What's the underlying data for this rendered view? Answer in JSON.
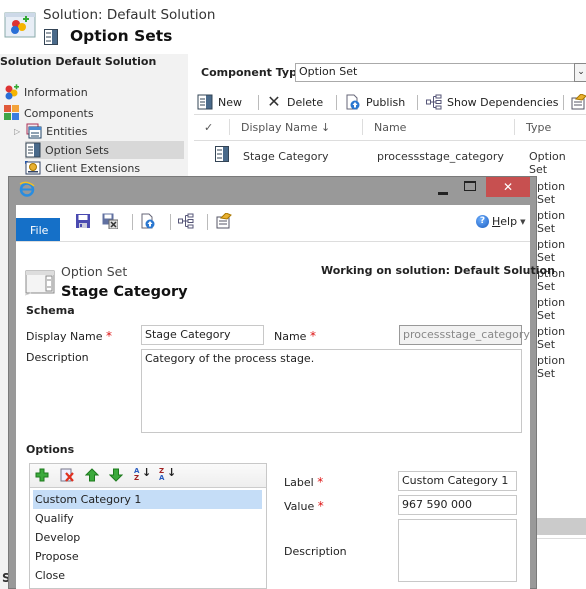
{
  "header": {
    "subtitle": "Solution: Default Solution",
    "title": "Option Sets"
  },
  "sidebar": {
    "title": "Solution Default Solution",
    "items": [
      {
        "label": "Information",
        "icon": "information-icon"
      },
      {
        "label": "Components",
        "icon": "components-icon"
      },
      {
        "label": "Entities",
        "icon": "entities-icon",
        "expandable": true
      },
      {
        "label": "Option Sets",
        "icon": "option-sets-icon",
        "selected": true
      },
      {
        "label": "Client Extensions",
        "icon": "client-extensions-icon"
      }
    ]
  },
  "component_type": {
    "label": "Component Type",
    "value": "Option Set"
  },
  "toolbar": {
    "new_label": "New",
    "delete_label": "Delete",
    "publish_label": "Publish",
    "show_dependencies_label": "Show Dependencies"
  },
  "grid": {
    "columns": [
      "Display Name ↓",
      "Name",
      "Type"
    ],
    "check_glyph": "✓",
    "rows": [
      {
        "display_name": "Stage Category",
        "name": "processstage_category",
        "type": "Option Set"
      }
    ],
    "obscured_type_values": [
      "ption Set",
      "ption Set",
      "ption Set",
      "ption Set",
      "ption Set",
      "ption Set",
      "ption Set"
    ]
  },
  "background_partial_text": "S",
  "dialog": {
    "window_controls": {
      "minimize": "_",
      "maximize": "☐",
      "close": "✕"
    },
    "file_tab": "File",
    "help_label": "Help",
    "help_underline_char": "H",
    "form_type": "Option Set",
    "form_title": "Stage Category",
    "working_on": "Working on solution: Default Solution",
    "schema": {
      "section_title": "Schema",
      "display_name_label": "Display Name",
      "display_name_value": "Stage Category",
      "name_label": "Name",
      "name_value": "processstage_category",
      "description_label": "Description",
      "description_value": "Category of the process stage.",
      "required_marker": "*"
    },
    "options": {
      "section_title": "Options",
      "items": [
        "Custom Category 1",
        "Qualify",
        "Develop",
        "Propose",
        "Close"
      ],
      "selected_index": 0,
      "label_label": "Label",
      "label_value": "Custom Category 1",
      "value_label": "Value",
      "value_value": "967 590 000",
      "description_label": "Description",
      "description_value": ""
    }
  }
}
